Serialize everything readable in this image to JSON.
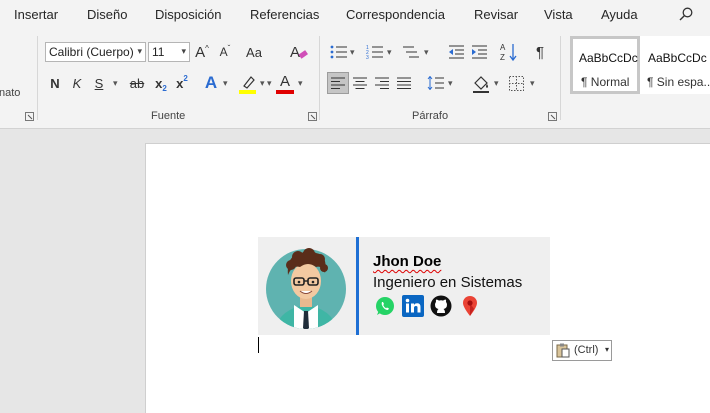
{
  "menu": {
    "tabs": [
      "Insertar",
      "Diseño",
      "Disposición",
      "Referencias",
      "Correspondencia",
      "Revisar",
      "Vista",
      "Ayuda"
    ],
    "cut_label": "nato"
  },
  "font_group": {
    "font_name": "Calibri (Cuerpo)",
    "font_size": "11",
    "label": "Fuente",
    "grow_glyph": "A",
    "shrink_glyph": "A",
    "case_glyph": "Aa",
    "bold_glyph": "N",
    "italic_glyph": "K",
    "underline_glyph": "S",
    "strike_glyph": "ab",
    "subscript_glyph": "x",
    "superscript_glyph": "x",
    "effects_glyph": "A",
    "font_color_glyph": "A",
    "highlight_color": "#ffff00",
    "font_color": "#e00000"
  },
  "paragraph_group": {
    "label": "Párrafo"
  },
  "styles_group": {
    "items": [
      {
        "sample": "AaBbCcDc",
        "name": "¶ Normal"
      },
      {
        "sample": "AaBbCcDc",
        "name": "¶ Sin espa..."
      }
    ]
  },
  "document": {
    "signature": {
      "name": "Jhon Doe",
      "title": "Ingeniero en Sistemas",
      "accent_color": "#1e6fd4",
      "icons": [
        "whatsapp-icon",
        "linkedin-icon",
        "github-icon",
        "location-pin-icon"
      ]
    },
    "paste_options_label": "(Ctrl)"
  }
}
